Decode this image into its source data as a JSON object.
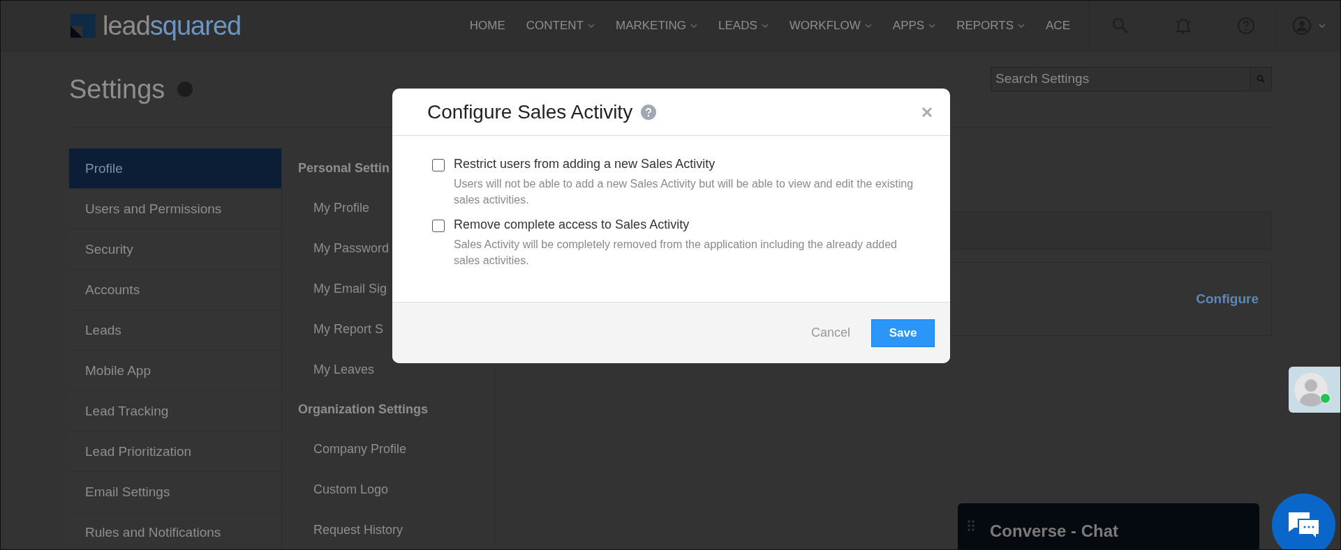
{
  "header": {
    "logo": {
      "first": "lead",
      "second": "squared"
    },
    "nav": [
      {
        "label": "HOME",
        "dropdown": false
      },
      {
        "label": "CONTENT",
        "dropdown": true
      },
      {
        "label": "MARKETING",
        "dropdown": true
      },
      {
        "label": "LEADS",
        "dropdown": true
      },
      {
        "label": "WORKFLOW",
        "dropdown": true
      },
      {
        "label": "APPS",
        "dropdown": true
      },
      {
        "label": "REPORTS",
        "dropdown": true
      },
      {
        "label": "ACE",
        "dropdown": false
      }
    ]
  },
  "page": {
    "title": "Settings",
    "search": {
      "placeholder": "Search Settings"
    }
  },
  "sidebar": {
    "items": [
      {
        "label": "Profile",
        "selected": true
      },
      {
        "label": "Users and Permissions",
        "selected": false
      },
      {
        "label": "Security",
        "selected": false
      },
      {
        "label": "Accounts",
        "selected": false
      },
      {
        "label": "Leads",
        "selected": false
      },
      {
        "label": "Mobile App",
        "selected": false
      },
      {
        "label": "Lead Tracking",
        "selected": false
      },
      {
        "label": "Lead Prioritization",
        "selected": false
      },
      {
        "label": "Email Settings",
        "selected": false
      },
      {
        "label": "Rules and Notifications",
        "selected": false
      }
    ]
  },
  "submenu": {
    "sections": [
      {
        "heading": "Personal Settin",
        "items": [
          "My Profile",
          "My Password",
          "My Email Sig",
          "My Report S",
          "My Leaves"
        ]
      },
      {
        "heading": "Organization Settings",
        "items": [
          "Company Profile",
          "Custom Logo",
          "Request History"
        ]
      }
    ]
  },
  "content": {
    "card_link": "Configure"
  },
  "dialog": {
    "title": "Configure Sales Activity",
    "options": [
      {
        "label": "Restrict users from adding a new Sales Activity",
        "description": "Users will not be able to add a new Sales Activity but will be able to view and edit the existing sales activities.",
        "checked": false
      },
      {
        "label": "Remove complete access to Sales Activity",
        "description": "Sales Activity will be completely removed from the application including the already added sales activities.",
        "checked": false
      }
    ],
    "cancel": "Cancel",
    "save": "Save"
  },
  "agent": {
    "online": true
  },
  "chat": {
    "title": "Converse - Chat"
  }
}
